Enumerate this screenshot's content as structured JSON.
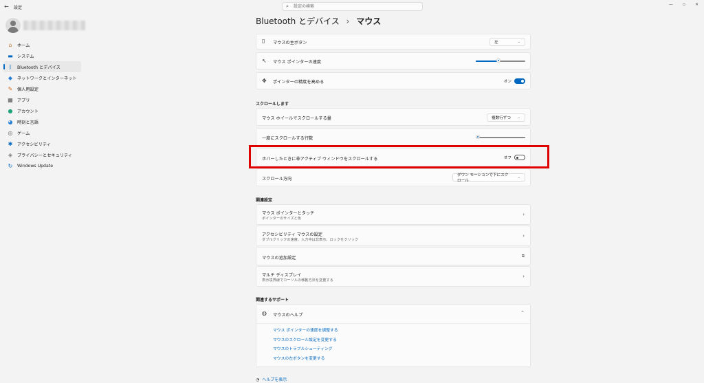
{
  "window": {
    "title": "設定",
    "controls": [
      "—",
      "▫",
      "✕"
    ]
  },
  "search": {
    "placeholder": "設定の検索"
  },
  "sidebar": {
    "items": [
      {
        "label": "ホーム",
        "icon": "home-icon",
        "glyph": "⌂",
        "color": "#c27c3a"
      },
      {
        "label": "システム",
        "icon": "monitor-icon",
        "glyph": "▬",
        "color": "#0067c0"
      },
      {
        "label": "Bluetooth とデバイス",
        "icon": "bluetooth-icon",
        "glyph": "ᛒ",
        "color": "#0067c0",
        "active": true
      },
      {
        "label": "ネットワークとインターネット",
        "icon": "wifi-icon",
        "glyph": "◆",
        "color": "#2a7fd4"
      },
      {
        "label": "個人用設定",
        "icon": "brush-icon",
        "glyph": "✎",
        "color": "#d26a1c"
      },
      {
        "label": "アプリ",
        "icon": "apps-icon",
        "glyph": "▦",
        "color": "#555555"
      },
      {
        "label": "アカウント",
        "icon": "person-icon",
        "glyph": "●",
        "color": "#1fa37a"
      },
      {
        "label": "時刻と言語",
        "icon": "globe-clock-icon",
        "glyph": "◕",
        "color": "#2a7fd4"
      },
      {
        "label": "ゲーム",
        "icon": "gamepad-icon",
        "glyph": "◎",
        "color": "#666666"
      },
      {
        "label": "アクセシビリティ",
        "icon": "accessibility-icon",
        "glyph": "✱",
        "color": "#0067c0"
      },
      {
        "label": "プライバシーとセキュリティ",
        "icon": "shield-icon",
        "glyph": "◈",
        "color": "#777777"
      },
      {
        "label": "Windows Update",
        "icon": "update-icon",
        "glyph": "↻",
        "color": "#0067c0"
      }
    ]
  },
  "breadcrumb": {
    "parent": "Bluetooth とデバイス",
    "separator": "›",
    "current": "マウス"
  },
  "settings": {
    "primary_button": {
      "label": "マウスの主ボタン",
      "value": "左"
    },
    "pointer_speed": {
      "label": "マウス ポインターの速度",
      "level": 0.46
    },
    "enhance_precision": {
      "label": "ポインターの精度を高める",
      "state": "オン"
    }
  },
  "scroll": {
    "heading": "スクロールします",
    "wheel_amount": {
      "label": "マウス ホイールでスクロールする量",
      "value": "複数行ずつ"
    },
    "lines": {
      "label": "一度にスクロールする行数",
      "level": 0.04
    },
    "inactive_scroll": {
      "label": "ホバーしたときに非アクティブ ウィンドウをスクロールする",
      "state": "オフ"
    },
    "direction": {
      "label": "スクロール方向",
      "value": "ダウン モーションで下にスクロール"
    }
  },
  "related": {
    "heading": "関連設定",
    "pointer_touch": {
      "title": "マウス ポインターとタッチ",
      "sub": "ポインターのサイズと色"
    },
    "accessibility_mouse": {
      "title": "アクセシビリティ マウスの設定",
      "sub": "ダブルクリックの速度、入力中は非表示、ロックをクリック"
    },
    "additional": {
      "title": "マウスの追加設定"
    },
    "multi_display": {
      "title": "マルチ ディスプレイ",
      "sub": "表示境界線でカーソルの移動方法を変更する"
    }
  },
  "support": {
    "heading": "関連するサポート",
    "help_title": "マウスのヘルプ",
    "links": [
      "マウス ポインターの速度を調整する",
      "マウスのスクロール設定を変更する",
      "マウスのトラブルシューティング",
      "マウスの左ボタンを変更する"
    ]
  },
  "footer": {
    "help_link": "ヘルプを表示"
  },
  "colors": {
    "accent": "#0067c0",
    "highlight": "#e10000"
  }
}
